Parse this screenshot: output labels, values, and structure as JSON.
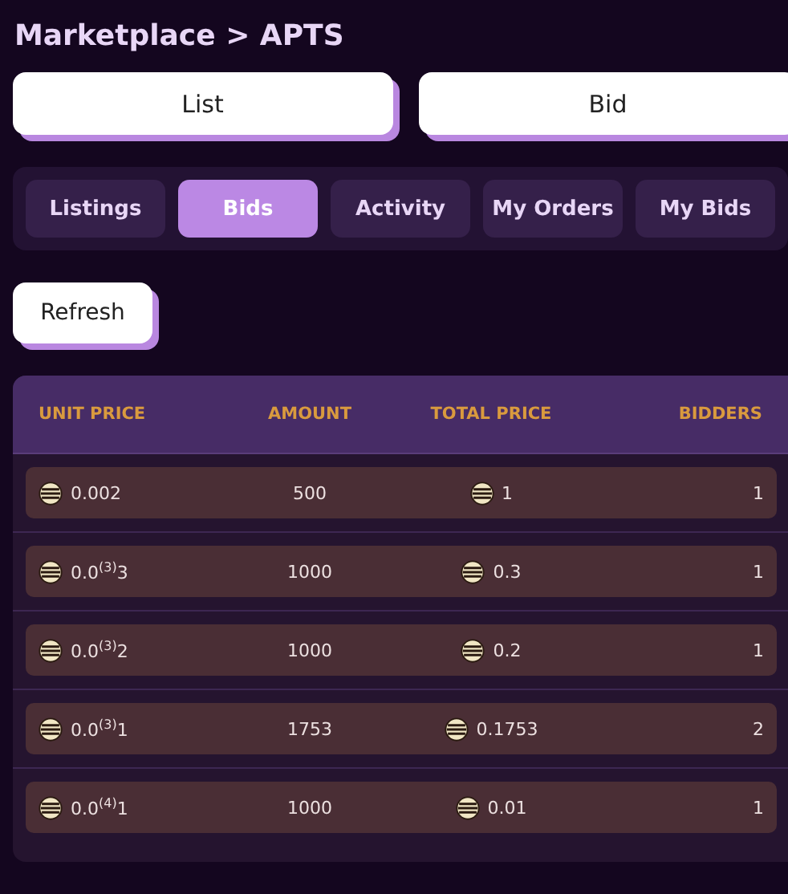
{
  "breadcrumb": "Marketplace > APTS",
  "actions": [
    "List",
    "Bid"
  ],
  "tabs": [
    {
      "label": "Listings",
      "selected": false
    },
    {
      "label": "Bids",
      "selected": true
    },
    {
      "label": "Activity",
      "selected": false
    },
    {
      "label": "My Orders",
      "selected": false
    },
    {
      "label": "My Bids",
      "selected": false
    }
  ],
  "refresh_button": "Refresh",
  "table": {
    "columns": [
      "UNIT PRICE",
      "AMOUNT",
      "TOTAL PRICE",
      "BIDDERS"
    ],
    "rows": [
      {
        "unit_price": "0.002",
        "amount": "500",
        "total_price": "1",
        "bidders": "1"
      },
      {
        "unit_price": "0.0$^{(3)}$3",
        "amount": "1000",
        "total_price": "0.3",
        "bidders": "1"
      },
      {
        "unit_price": "0.0$^{(3)}$2",
        "amount": "1000",
        "total_price": "0.2",
        "bidders": "1"
      },
      {
        "unit_price": "0.0$^{(3)}$1",
        "amount": "1753",
        "total_price": "0.1753",
        "bidders": "2"
      },
      {
        "unit_price": "0.0$^{(4)}$1",
        "amount": "1000",
        "total_price": "0.01",
        "bidders": "1"
      }
    ]
  }
}
